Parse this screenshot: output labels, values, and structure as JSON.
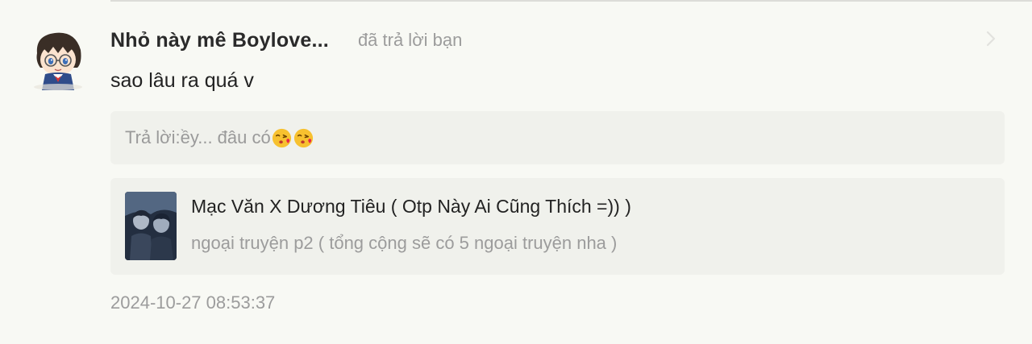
{
  "notification": {
    "username": "Nhỏ này mê Boylove...",
    "action": "đã trả lời bạn",
    "comment": "sao lâu ra quá v",
    "reply": {
      "prefix": "Trả lời: ",
      "text": "ềy... đâu có",
      "emojis": [
        "kissing-face-emoji",
        "kissing-face-emoji"
      ]
    },
    "story": {
      "title": "Mạc Văn X Dương Tiêu ( Otp Này Ai Cũng Thích =)) )",
      "chapter": "ngoại truyện p2 ( tổng cộng sẽ có 5 ngoại truyện nha )"
    },
    "timestamp": "2024-10-27 08:53:37"
  },
  "icons": {
    "avatar": "anime-boy-avatar",
    "chevron": "chevron-right-icon"
  },
  "colors": {
    "background": "#f8f9f4",
    "card": "#f0f1ec",
    "primary_text": "#222222",
    "secondary_text": "#9c9c9c"
  }
}
